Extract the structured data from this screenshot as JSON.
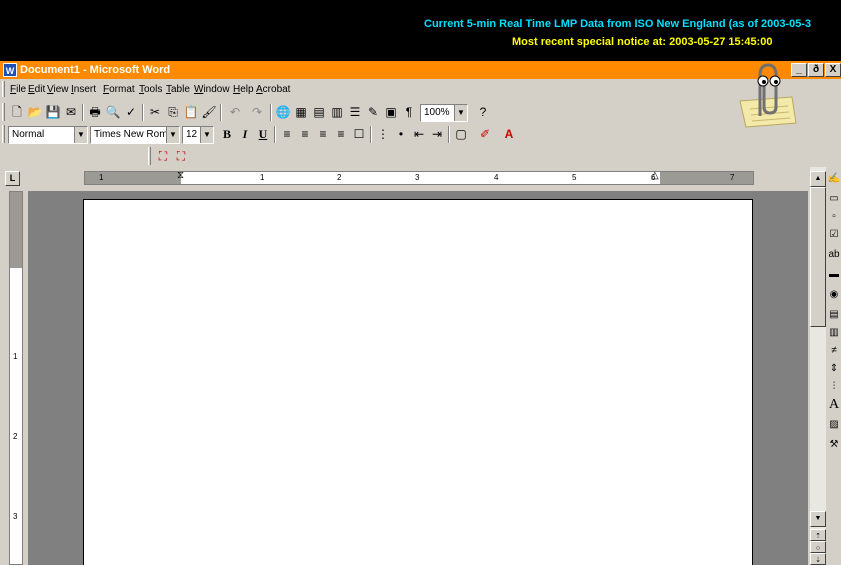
{
  "banner": {
    "line1": "Current 5-min Real Time LMP Data from ISO New England (as of 2003-05-3",
    "line2": "Most recent special notice at: 2003-05-27 15:45:00"
  },
  "window": {
    "title": "Document1 - Microsoft Word",
    "app_icon_label": "W",
    "controls": [
      "_",
      "ð",
      "X"
    ]
  },
  "menu": [
    "File",
    "Edit",
    "View",
    "Insert",
    "Format",
    "Tools",
    "Table",
    "Window",
    "Help",
    "Acrobat"
  ],
  "standard_toolbar": {
    "zoom": "100%",
    "icons": [
      "new-icon",
      "open-icon",
      "save-icon",
      "email-icon",
      "print-icon",
      "print-preview-icon",
      "spelling-icon",
      "cut-icon",
      "copy-icon",
      "paste-icon",
      "format-painter-icon",
      "undo-icon",
      "redo-icon",
      "hyperlink-icon",
      "tables-borders-icon",
      "insert-table-icon",
      "insert-excel-icon",
      "columns-icon",
      "drawing-icon",
      "document-map-icon",
      "show-hide-icon",
      "help-icon"
    ]
  },
  "formatting_toolbar": {
    "style": "Normal",
    "font": "Times New Roman",
    "size": "12"
  },
  "acrobat_toolbar": {
    "icons": [
      "convert-to-pdf-icon",
      "convert-and-email-pdf-icon"
    ]
  },
  "ruler": {
    "marks": [
      "1",
      "2",
      "3",
      "4",
      "5",
      "6",
      "7"
    ]
  },
  "vertical_ruler": {
    "marks": [
      "1",
      "2",
      "3"
    ]
  },
  "colors": {
    "banner_line1": "#00e0ff",
    "banner_line2": "#ffff00",
    "titlebar": "#ff8a00",
    "chrome": "#d4d0c8",
    "doc_background": "#808080"
  }
}
